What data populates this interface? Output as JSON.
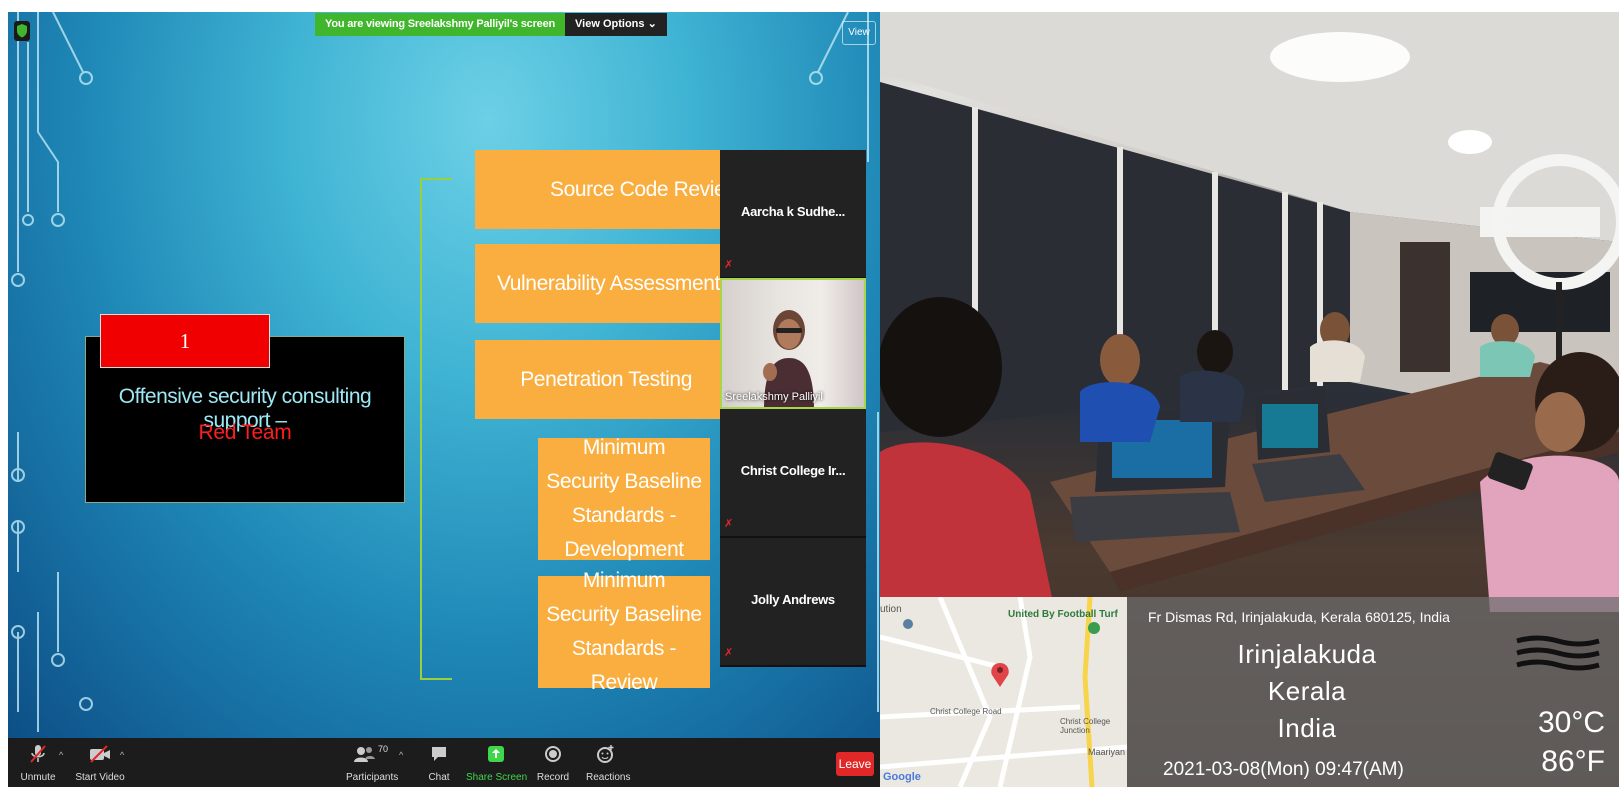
{
  "share_bar": {
    "notice": "You are viewing Sreelakshmy Palliyil's screen",
    "view_options": "View Options ⌄"
  },
  "view_button": "View",
  "slide": {
    "number": "1",
    "title": "Offensive security consulting support –",
    "subtitle": "Red Team",
    "boxes": [
      "Source Code Review",
      "Vulnerability Assessment",
      "Penetration Testing",
      "Minimum Security Baseline Standards - Development",
      "Minimum Security Baseline Standards - Review"
    ]
  },
  "participants_strip": [
    {
      "name": "Aarcha k Sudhe..."
    },
    {
      "name": "Sreelakshmy Palliyil"
    },
    {
      "name": "Christ College Ir..."
    },
    {
      "name": "Jolly Andrews"
    }
  ],
  "toolbar": {
    "unmute": "Unmute",
    "start_video": "Start Video",
    "participants": "Participants",
    "participant_count": "70",
    "chat": "Chat",
    "share_screen": "Share Screen",
    "record": "Record",
    "reactions": "Reactions",
    "leave": "Leave"
  },
  "map": {
    "labels": [
      "United By Football Turf",
      "Christ College Road",
      "Christ College Junction",
      "Maariyan",
      "Google",
      "ution"
    ]
  },
  "geo_overlay": {
    "address": "Fr Dismas Rd, Irinjalakuda, Kerala 680125, India",
    "city": "Irinjalakuda",
    "state": "Kerala",
    "country": "India",
    "datetime": "2021-03-08(Mon)   09:47(AM)",
    "temp_c": "30°C",
    "temp_f": "86°F"
  },
  "colors": {
    "share_green": "#3fb62b",
    "slide_orange": "#f9ae3f",
    "leave_red": "#e02828",
    "title_cyan": "#9de8f4"
  }
}
